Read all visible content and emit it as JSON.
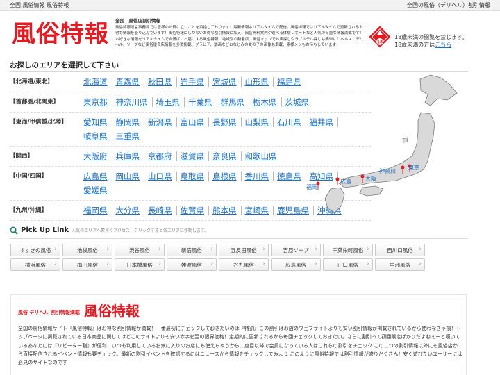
{
  "topbar": {
    "left": "全国 風俗情報 風俗特報",
    "right": "全国の風俗（デリヘル）割引情報"
  },
  "header": {
    "logo": "風俗特報",
    "desc_title": "全国　風俗店割引情報",
    "desc_body": "風俗特報運営事務局では皆様のお役に立つことを目指しております！最新情報もリアルタイムで配信。風俗特報ではリアルタイムで更新されるお得な情報を盛り込んでいます！風俗特報にしかないお得な割引情報に加え、風俗無料案内や遊べる体験レポートなど人気の有益な情報満載です！お好きな情報をリアルタイムで自慢げにお届けする風俗特報。地域別の新着店、風俗マップでお店探しやラブホテル探しも簡単に！ヘルス、デリヘル、ソープなど風俗優良店情報を多数掲載、グラビア、動画などおなじみの女の子の画像も満載、素様メンもお待ちしています！",
    "age_line1": "18歳未満の閲覧を禁じます。",
    "age_line2": "18歳未満の方は",
    "age_link": "こちら"
  },
  "area": {
    "title": "お探しのエリアを選択して下さい",
    "regions": [
      {
        "name": "【北海道/東北】",
        "prefs": [
          "北海道",
          "青森県",
          "秋田県",
          "岩手県",
          "宮城県",
          "山形県",
          "福島県"
        ]
      },
      {
        "name": "【首都圏/北関東】",
        "prefs": [
          "東京都",
          "神奈川県",
          "埼玉県",
          "千葉県",
          "群馬県",
          "栃木県",
          "茨城県"
        ]
      },
      {
        "name": "【東海/甲信越/北陸】",
        "prefs": [
          "愛知県",
          "静岡県",
          "新潟県",
          "富山県",
          "長野県",
          "山梨県",
          "石川県",
          "福井県",
          "岐阜県",
          "三重県"
        ]
      },
      {
        "name": "【関西】",
        "prefs": [
          "大阪府",
          "兵庫県",
          "京都府",
          "滋賀県",
          "奈良県",
          "和歌山県"
        ]
      },
      {
        "name": "【中国/四国】",
        "prefs": [
          "広島県",
          "岡山県",
          "山口県",
          "鳥取県",
          "島根県",
          "香川県",
          "徳島県",
          "高知県",
          "愛媛県"
        ]
      },
      {
        "name": "【九州/沖縄】",
        "prefs": [
          "福岡県",
          "大分県",
          "長崎県",
          "佐賀県",
          "熊本県",
          "宮崎県",
          "鹿児島県",
          "沖縄県"
        ]
      }
    ],
    "map_labels": [
      "神奈川",
      "東京",
      "大阪",
      "広島",
      "福岡"
    ]
  },
  "pickup": {
    "title": "Pick Up Link",
    "desc": "人気のエリアへ素早くアクセス！クリックすると各エリアに移動します。",
    "links": [
      "すすきの風俗",
      "池袋風俗",
      "渋谷風俗",
      "新宿風俗",
      "五反田風俗",
      "吉原ソープ",
      "千葉栄町風俗",
      "西川口風俗",
      "横浜風俗",
      "梅田風俗",
      "日本橋風俗",
      "難波風俗",
      "谷九風俗",
      "広島風俗",
      "山口風俗",
      "中洲風俗"
    ]
  },
  "info": {
    "tag": "風俗 デリヘル 割引情報満載",
    "logo": "風俗特報",
    "text": "全国の風俗情報サイト『風俗特報』はお得な割引情報が満載！一番最初にチェックしておきたいのは『特割』この割引はお店のウェブサイトよりも安い割引情報が掲載されているから使わなきゃ損！トップページに掲載されている日本商品に関してはどこのサイトよりも安い赤字必至の限界価格！定期的に更新されるから毎回チェックしておきたい。さらに割引って初回限定ばかりだよねぇーと嘆いているあなたには『リピーター割』が便利！いつも利用しているお気に入りのお店にも使えちゃうから二度目以降で会員になっている人はこれらの割引をチェック この二つの割引情報以外にも風俗店から直接配信されるイベント情報も要チェック。最新の割引イベントを確認するにはニュースから情報をチェックしてみよう このように風俗特報では割引情報が盛りだくさん！安く遊びたいユーザーには必見のサイトなのです"
  }
}
